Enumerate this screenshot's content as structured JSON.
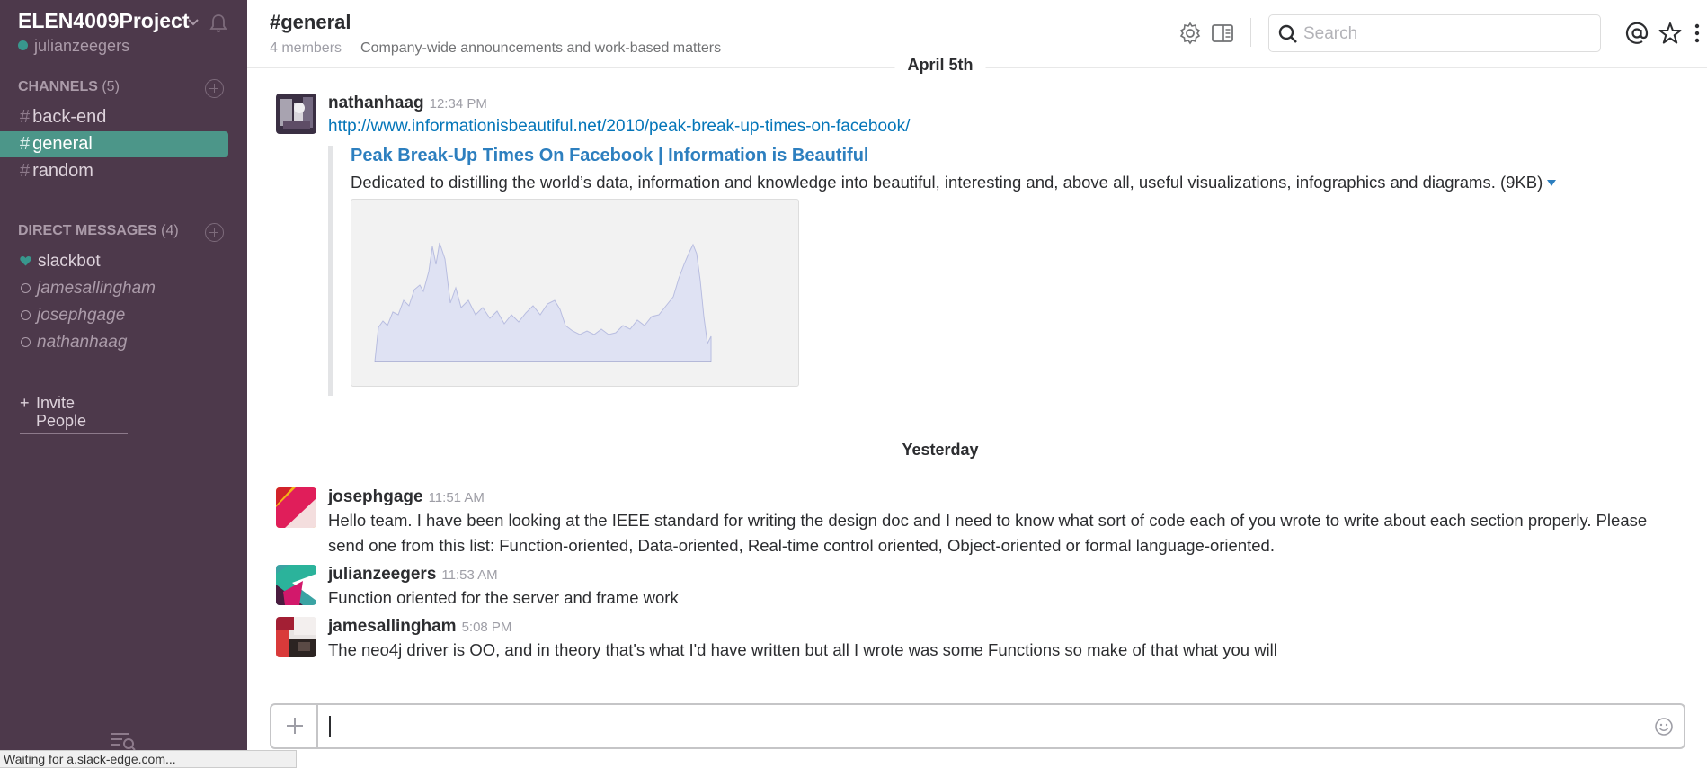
{
  "sidebar": {
    "team_name": "ELEN4009Project",
    "current_user": "julianzeegers",
    "channels_header": "CHANNELS",
    "channels_count": "(5)",
    "channels": [
      {
        "hash": "#",
        "name": "back-end"
      },
      {
        "hash": "#",
        "name": "general"
      },
      {
        "hash": "#",
        "name": "random"
      }
    ],
    "dm_header": "DIRECT MESSAGES",
    "dm_count": "(4)",
    "dms": [
      {
        "name": "slackbot"
      },
      {
        "name": "jamesallingham"
      },
      {
        "name": "josephgage"
      },
      {
        "name": "nathanhaag"
      }
    ],
    "invite_plus": "+",
    "invite_label": "Invite People"
  },
  "header": {
    "channel": "#general",
    "members": "4 members",
    "purpose": "Company-wide announcements and work-based matters",
    "search_placeholder": "Search"
  },
  "messages": {
    "day1": "April 5th",
    "day2": "Yesterday",
    "m1": {
      "sender": "nathanhaag",
      "time": "12:34 PM",
      "link": "http://www.informationisbeautiful.net/2010/peak-break-up-times-on-facebook/",
      "attachment_title": "Peak Break-Up Times On Facebook | Information is Beautiful",
      "attachment_desc": "Dedicated to distilling the world’s data, information and knowledge into beautiful, interesting and, above all, useful visualizations, infographics and diagrams. (9KB)"
    },
    "m2": {
      "sender": "josephgage",
      "time": "11:51 AM",
      "text": "Hello team. I have been looking at the IEEE standard for writing the design doc and I need to know what sort of code each of you wrote to write about each section properly. Please send one from this list: Function-oriented, Data-oriented, Real-time control oriented, Object-oriented or formal language-oriented."
    },
    "m3": {
      "sender": "julianzeegers",
      "time": "11:53 AM",
      "text": "Function oriented for the server and frame work"
    },
    "m4": {
      "sender": "jamesallingham",
      "time": "5:08 PM",
      "text": "The neo4j driver is OO, and in theory that's what I'd have written but all I wrote was some Functions so make of that what you will"
    }
  },
  "composer": {
    "value": ""
  },
  "status_bar": "Waiting for a.slack-edge.com...",
  "colors": {
    "sidebar_bg": "#4d394b",
    "active_channel": "#4c9689",
    "link": "#0576b9",
    "presence": "#38978d"
  },
  "icons": [
    "chevron-down-icon",
    "bell-icon",
    "gear-icon",
    "sidebar-toggle-icon",
    "search-icon",
    "at-mention-icon",
    "star-icon",
    "more-vertical-icon",
    "heart-icon",
    "emoji-icon"
  ]
}
